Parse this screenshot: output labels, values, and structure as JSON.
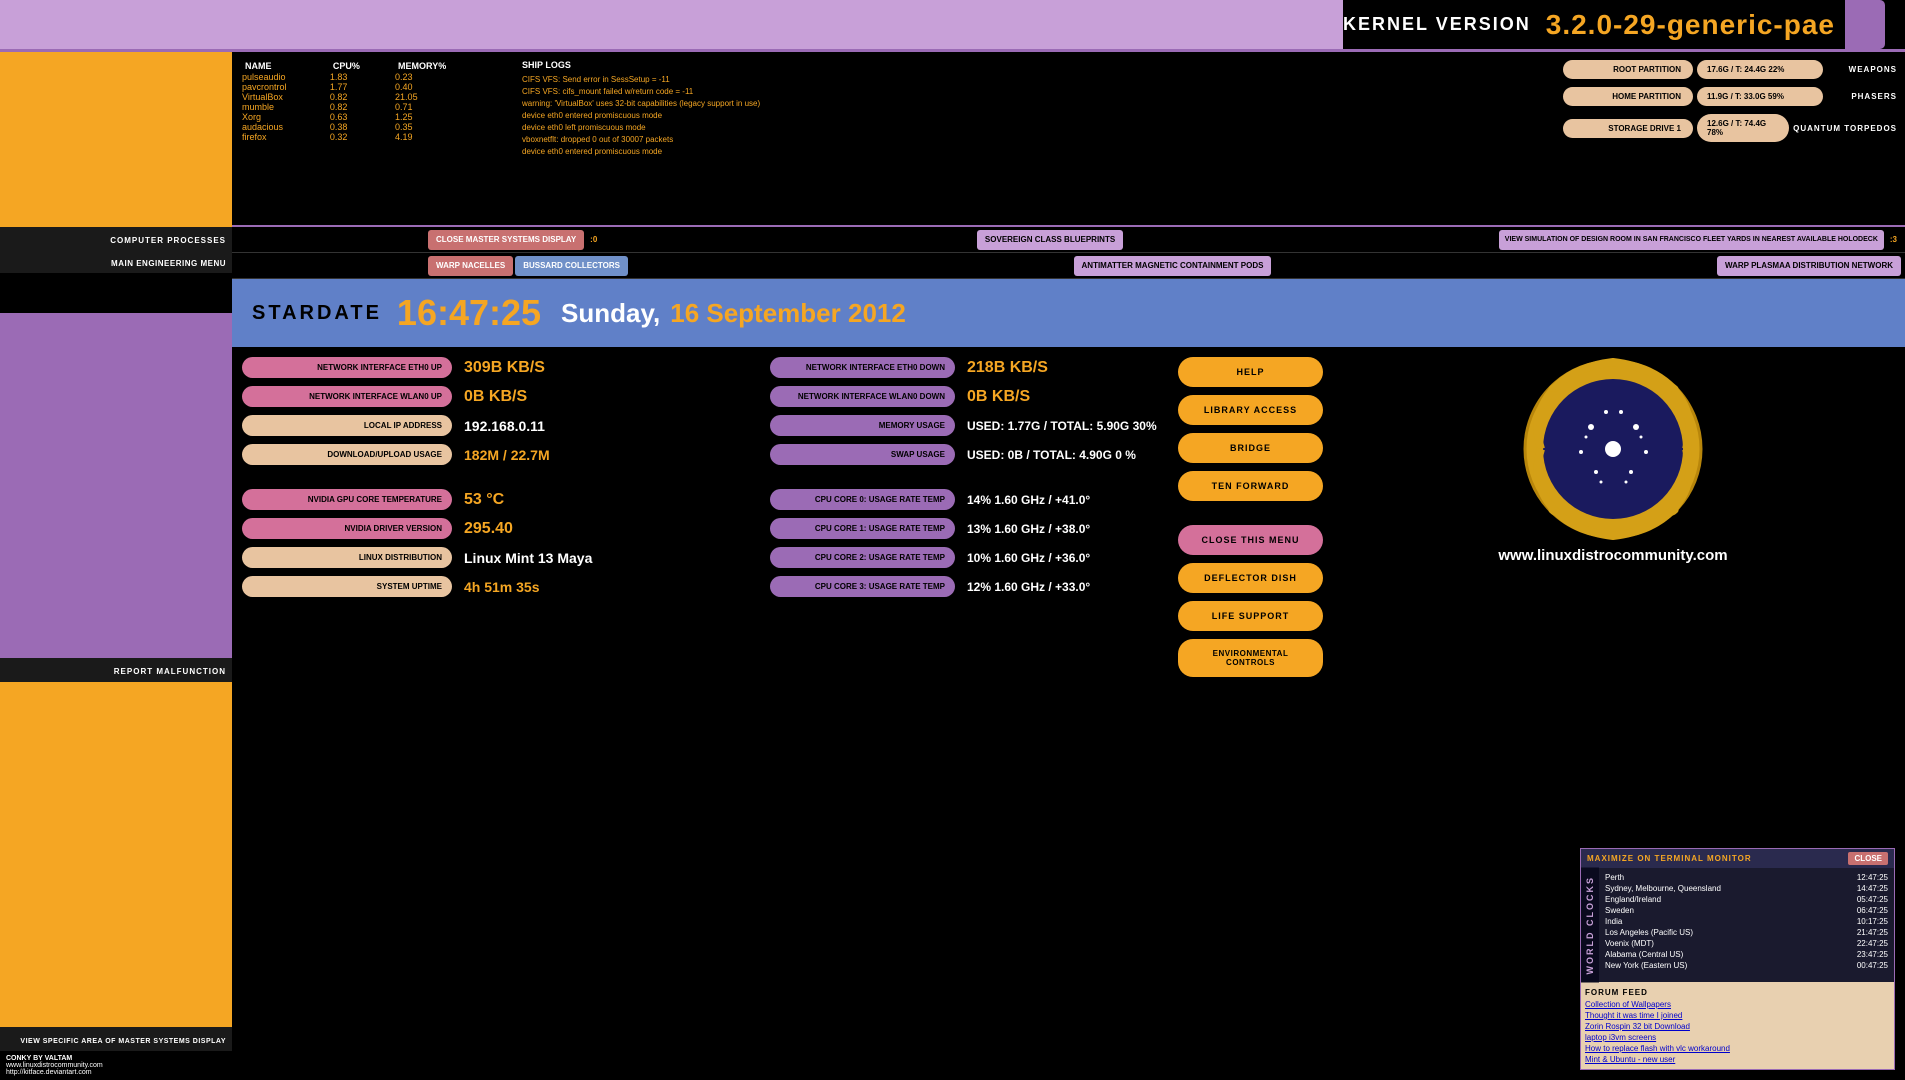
{
  "topbar": {
    "kernel_label": "KERNEL VERSION",
    "kernel_version": "3.2.0-29-generic-pae"
  },
  "processes": {
    "title": "COMPUTER PROCESSES",
    "menu_label": "MAIN ENGINEERING MENU",
    "headers": [
      "NAME",
      "CPU%",
      "MEMORY%"
    ],
    "rows": [
      {
        "name": "pulseaudio",
        "cpu": "1.83",
        "mem": "0.23"
      },
      {
        "name": "pavcrontrol",
        "cpu": "1.77",
        "mem": "0.40"
      },
      {
        "name": "VirtualBox",
        "cpu": "0.82",
        "mem": "21.05"
      },
      {
        "name": "mumble",
        "cpu": "0.82",
        "mem": "0.71"
      },
      {
        "name": "Xorg",
        "cpu": "0.63",
        "mem": "1.25"
      },
      {
        "name": "audacious",
        "cpu": "0.38",
        "mem": "0.35"
      },
      {
        "name": "firefox",
        "cpu": "0.32",
        "mem": "4.19"
      }
    ]
  },
  "ship_logs": {
    "title": "SHIP LOGS",
    "lines": [
      "CIFS VFS: Send error in SessSetup = -11",
      "CIFS VFS: cifs_mount failed w/return code = -11",
      "warning:  'VirtualBox' uses 32-bit capabilities (legacy support in use)",
      "device eth0 entered promiscuous mode",
      "device eth0 left promiscuous mode",
      "vboxnetflt: dropped 0 out of 30007 packets",
      "device eth0 entered promiscuous mode"
    ]
  },
  "weapons": {
    "root_label": "ROOT PARTITION",
    "root_value": "17.6G / T: 24.4G 22%",
    "root_weapon": "WEAPONS",
    "home_label": "HOME PARTITION",
    "home_value": "11.9G / T: 33.0G 59%",
    "home_weapon": "PHASERS",
    "storage_label": "STORAGE DRIVE 1",
    "storage_value": "12.6G / T: 74.4G 78%",
    "storage_weapon": "QUANTUM TORPEDOS"
  },
  "navbar1": {
    "close_master": "CLOSE MASTER SYSTEMS DISPLAY",
    "close_num": ":0",
    "blueprints": "SOVEREIGN CLASS BLUEPRINTS",
    "simulation": "VIEW SIMULATION OF DESIGN ROOM IN SAN FRANCISCO FLEET YARDS IN NEAREST AVAILABLE HOLODECK",
    "sim_num": ":3"
  },
  "navbar2": {
    "warp": "WARP NACELLES",
    "bussard": "BUSSARD COLLECTORS",
    "antimatter": "ANTIMATTER MAGNETIC CONTAINMENT PODS",
    "warp_plasma": "WARP PLASMAA DISTRIBUTION NETWORK"
  },
  "stardate": {
    "label": "STARDATE",
    "time": "16:47:25",
    "day": "Sunday,",
    "date": "16 September 2012"
  },
  "network": {
    "eth0_up_label": "NETWORK INTERFACE ETH0 UP",
    "eth0_up_value": "309B KB/S",
    "eth0_down_label": "NETWORK INTERFACE ETH0 DOWN",
    "eth0_down_value": "218B KB/S",
    "wlan0_up_label": "NETWORK INTERFACE WLAN0 UP",
    "wlan0_up_value": "0B  KB/S",
    "wlan0_down_label": "NETWORK INTERFACE WLAN0 DOWN",
    "wlan0_down_value": "0B  KB/S",
    "local_ip_label": "LOCAL IP ADDRESS",
    "local_ip_value": "192.168.0.11",
    "memory_label": "MEMORY USAGE",
    "memory_value": "USED: 1.77G / TOTAL: 5.90G  30%",
    "download_label": "DOWNLOAD/UPLOAD USAGE",
    "download_value": "182M  / 22.7M",
    "swap_label": "SWAP USAGE",
    "swap_value": "USED: 0B   / TOTAL: 4.90G    0 %"
  },
  "actions": {
    "help": "HELP",
    "library": "LIBRARY ACCESS",
    "bridge": "BRIDGE",
    "ten_forward": "TEN FORWARD",
    "close_menu": "CLOSE THIS MENU",
    "deflector": "DEFLECTOR DISH",
    "life_support": "LIFE SUPPORT",
    "env_controls": "ENVIRONMENTAL CONTROLS"
  },
  "gpu": {
    "temp_label": "NVIDIA GPU CORE TEMPERATURE",
    "temp_value": "53 °C",
    "driver_label": "NVIDIA DRIVER VERSION",
    "driver_value": "295.40",
    "distro_label": "LINUX DISTRIBUTION",
    "distro_value": "Linux Mint 13 Maya",
    "uptime_label": "SYSTEM UPTIME",
    "uptime_value": "4h 51m 35s"
  },
  "cpu_cores": {
    "core0_label": "CPU CORE 0: USAGE RATE TEMP",
    "core0_value": "14%  1.60 GHz /  +41.0°",
    "core1_label": "CPU CORE 1: USAGE RATE TEMP",
    "core1_value": "13%  1.60 GHz /  +38.0°",
    "core2_label": "CPU CORE 2: USAGE RATE TEMP",
    "core2_value": "10%  1.60 GHz /  +36.0°",
    "core3_label": "CPU CORE 3: USAGE RATE TEMP",
    "core3_value": "12%  1.60 GHz /  +33.0°"
  },
  "world_clocks": {
    "title": "WORLD CLOCKS",
    "maximize_label": "MAXIMIZE ON TERMINAL MONITOR",
    "close_label": "CLOSE",
    "cities": [
      {
        "city": "Perth",
        "time": "12:47:25"
      },
      {
        "city": "Sydney, Melbourne, Queensland",
        "time": "14:47:25"
      },
      {
        "city": "England/Ireland",
        "time": "05:47:25"
      },
      {
        "city": "Sweden",
        "time": "06:47:25"
      },
      {
        "city": "India",
        "time": "10:17:25"
      },
      {
        "city": "Los Angeles (Pacific US)",
        "time": "21:47:25"
      },
      {
        "city": "Voenix (MDT)",
        "time": "22:47:25"
      },
      {
        "city": "Alabama (Central US)",
        "time": "23:47:25"
      },
      {
        "city": "New York (Eastern US)",
        "time": "00:47:25"
      }
    ]
  },
  "forum_feed": {
    "label": "FORUM FEED",
    "links": [
      "Collection of Wallpapers",
      "Thought it was time I joined",
      "Zorin Rospin 32 bit Download",
      "laptop i3vm screens",
      "How to replace flash with vlc workaround",
      "Mint & Ubuntu - new user"
    ]
  },
  "website": "www.linuxdistrocommunity.com",
  "conky": {
    "title": "CONKY BY VALTAM",
    "line1": "www.linuxdistrocommunity.com",
    "line2": "http://kitface.deviantart.com"
  }
}
